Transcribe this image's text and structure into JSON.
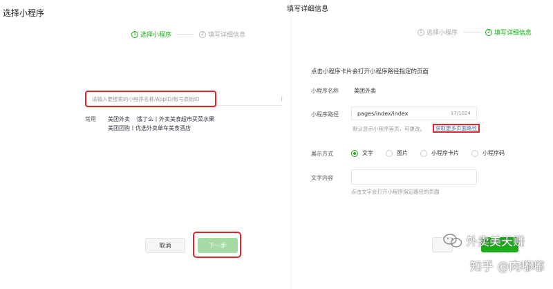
{
  "left": {
    "title": "选择小程序",
    "steps": [
      {
        "num": "1",
        "label": "选择小程序"
      },
      {
        "num": "2",
        "label": "填写详细信息"
      }
    ],
    "search": {
      "placeholder": "请输入要搜索的小程序名称/AppID/帐号原始ID"
    },
    "common": {
      "label": "常用",
      "row1": [
        "美团外卖",
        "饿了么丨外卖美食超市买菜水果"
      ],
      "row2": [
        "美团团购丨优选外卖单车美食酒店"
      ]
    },
    "buttons": {
      "cancel": "取消",
      "next": "下一步"
    }
  },
  "right": {
    "title": "填写详细信息",
    "steps": [
      {
        "num": "1",
        "label": "选择小程序"
      },
      {
        "num": "2",
        "label": "填写详细信息"
      }
    ],
    "description": "点击小程序卡片会打开小程序路径指定的页面",
    "name_label": "小程序名称",
    "name_value": "美团外卖",
    "path_label": "小程序路径",
    "path_value": "pages/index/index",
    "path_count": "17/1024",
    "path_hint": "默认显示小程序首页，可更改。",
    "more_paths": "获取更多页面路径",
    "display_label": "展示方式",
    "display_options": [
      "文字",
      "图片",
      "小程序卡片",
      "小程序码"
    ],
    "text_label": "文字内容",
    "text_hint": "点击文字会打开小程序指定路径的页面",
    "buttons": {
      "cancel": "",
      "confirm": ""
    }
  },
  "watermark": {
    "line1": "外卖美天赚",
    "line2": "知乎 @肉嘟嘟"
  },
  "colors": {
    "accent": "#1aad19",
    "highlight": "#e0252b",
    "link": "#576b95"
  }
}
